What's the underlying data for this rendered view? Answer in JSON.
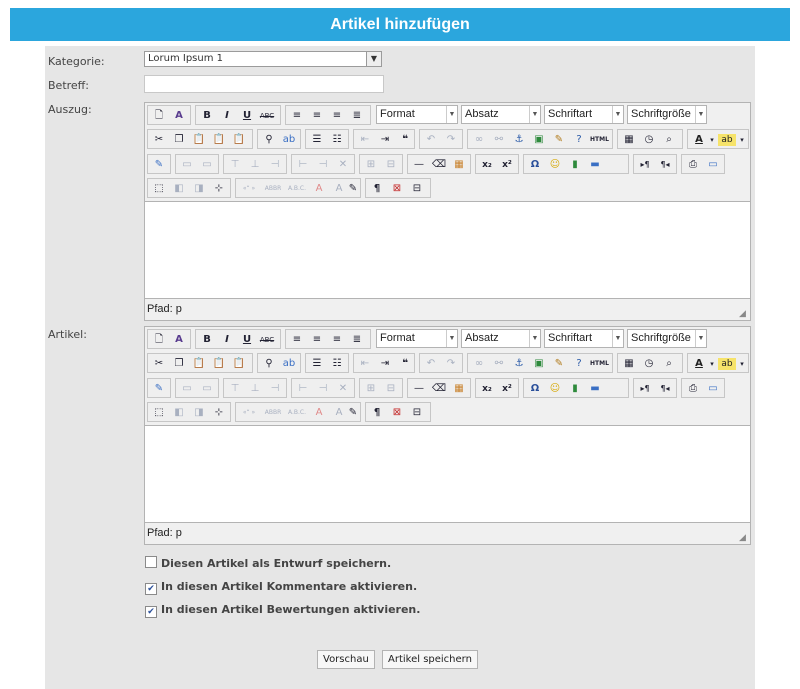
{
  "header": {
    "title": "Artikel hinzufügen"
  },
  "form": {
    "kategorie_label": "Kategorie:",
    "kategorie_value": "Lorum Ipsum 1",
    "betreff_label": "Betreff:",
    "betreff_value": "",
    "auszug_label": "Auszug:",
    "artikel_label": "Artikel:"
  },
  "editor": {
    "format_label": "Format",
    "absatz_label": "Absatz",
    "schriftart_label": "Schriftart",
    "schriftgroesse_label": "Schriftgröße",
    "path_label": "Pfad: p"
  },
  "options": {
    "entwurf": {
      "label": "Diesen Artikel als Entwurf speichern.",
      "checked": false
    },
    "kommentare": {
      "label": "In diesen Artikel Kommentare aktivieren.",
      "checked": true
    },
    "bewertungen": {
      "label": "In diesen Artikel Bewertungen aktivieren.",
      "checked": true
    }
  },
  "buttons": {
    "vorschau": "Vorschau",
    "speichern": "Artikel speichern"
  },
  "colors": {
    "header_bg": "#2ba6dd",
    "panel_bg": "#e6e6e6"
  }
}
